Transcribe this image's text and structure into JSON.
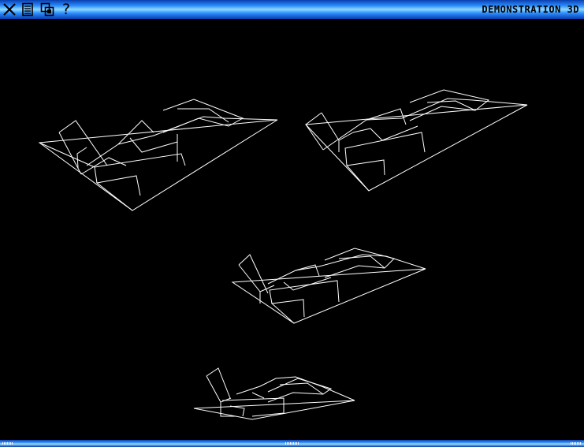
{
  "window": {
    "title": "DEMONSTRATION 3D",
    "accent_color": "#2a8cff",
    "background_color": "#000000",
    "wireframe_color": "#ffffff"
  },
  "toolbar": {
    "icons": [
      "close-icon",
      "document-icon",
      "windows-icon",
      "help-icon"
    ],
    "help_glyph": "?"
  },
  "scene": {
    "objects": [
      "jet-wireframe-1",
      "jet-wireframe-2",
      "jet-wireframe-3",
      "jet-wireframe-4"
    ]
  }
}
